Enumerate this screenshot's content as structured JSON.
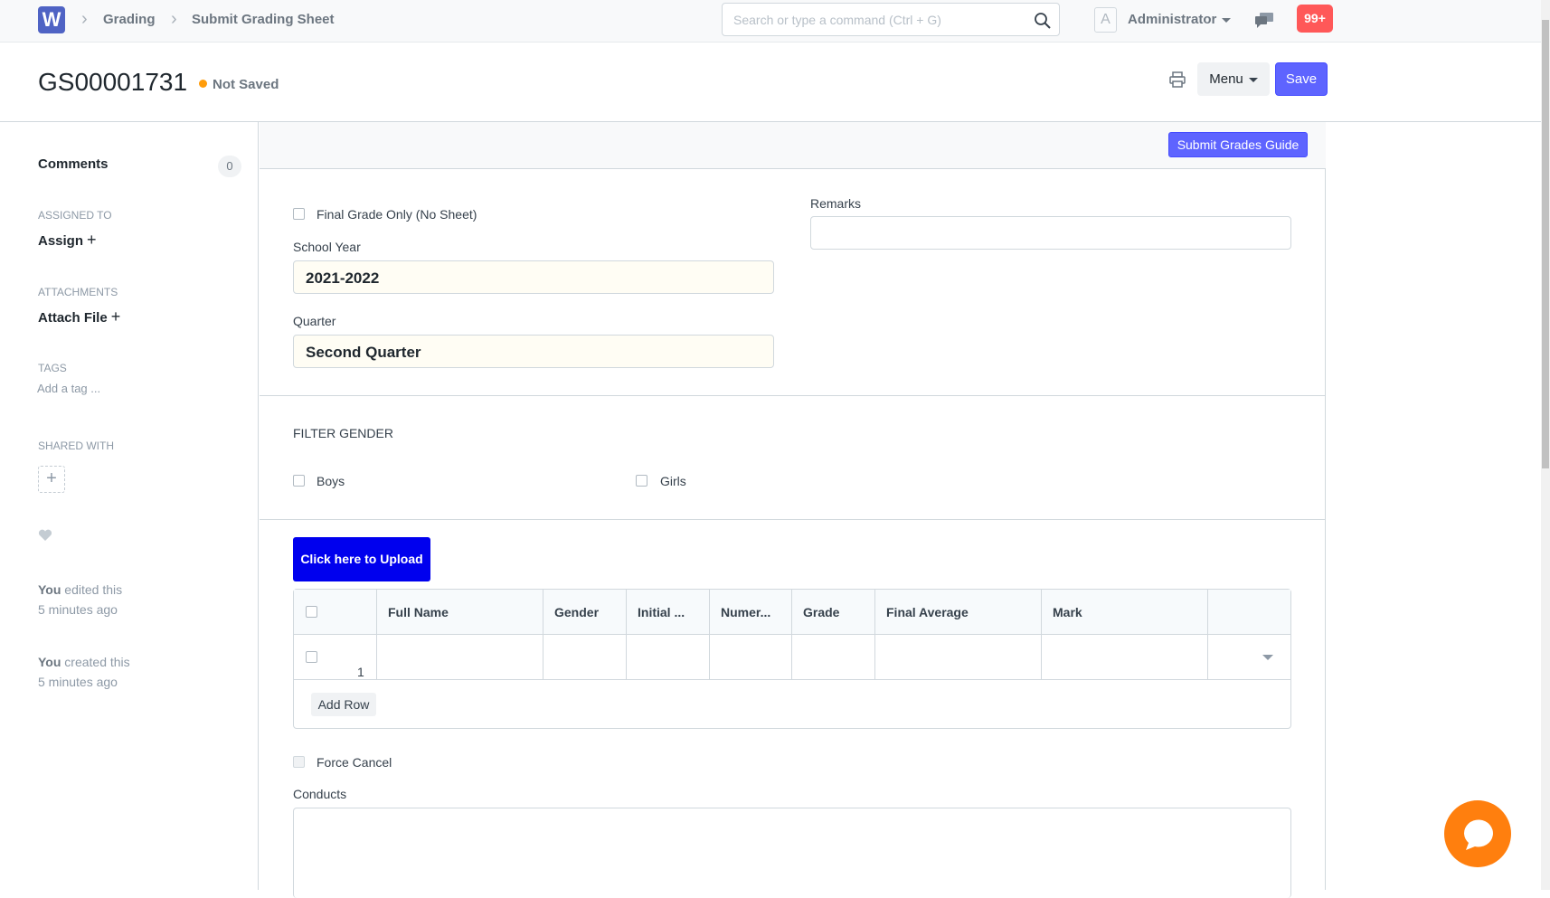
{
  "navbar": {
    "logo": "W",
    "breadcrumbs": [
      "Grading",
      "Submit Grading Sheet"
    ],
    "search_placeholder": "Search or type a command (Ctrl + G)",
    "avatar_letter": "A",
    "user": "Administrator",
    "notifications": "99+"
  },
  "header": {
    "title": "GS00001731",
    "status": "Not Saved",
    "menu_label": "Menu",
    "save_label": "Save"
  },
  "sidebar": {
    "comments_label": "Comments",
    "comments_count": "0",
    "assigned_to_label": "ASSIGNED TO",
    "assign_label": "Assign",
    "attachments_label": "ATTACHMENTS",
    "attach_label": "Attach File",
    "tags_label": "TAGS",
    "tag_placeholder": "Add a tag ...",
    "shared_with_label": "SHARED WITH",
    "activity": [
      {
        "who": "You",
        "action": "edited this",
        "when": "5 minutes ago"
      },
      {
        "who": "You",
        "action": "created this",
        "when": "5 minutes ago"
      }
    ]
  },
  "form": {
    "guide_button": "Submit Grades Guide",
    "final_grade_only_label": "Final Grade Only (No Sheet)",
    "school_year_label": "School Year",
    "school_year_value": "2021-2022",
    "quarter_label": "Quarter",
    "quarter_value": "Second Quarter",
    "remarks_label": "Remarks",
    "filter_gender_title": "FILTER GENDER",
    "boys_label": "Boys",
    "girls_label": "Girls",
    "upload_button": "Click here to Upload",
    "table": {
      "columns": [
        "Full Name",
        "Gender",
        "Initial ...",
        "Numer...",
        "Grade",
        "Final Average",
        "Mark"
      ],
      "rows": [
        {
          "index": "1"
        }
      ],
      "add_row_label": "Add Row"
    },
    "force_cancel_label": "Force Cancel",
    "conducts_label": "Conducts"
  },
  "colors": {
    "primary": "#5e64ff",
    "upload_button": "#0000ee",
    "notification": "#ff5858",
    "status_dot": "#ff9c0a",
    "chat_fab": "#ff7f0e"
  }
}
